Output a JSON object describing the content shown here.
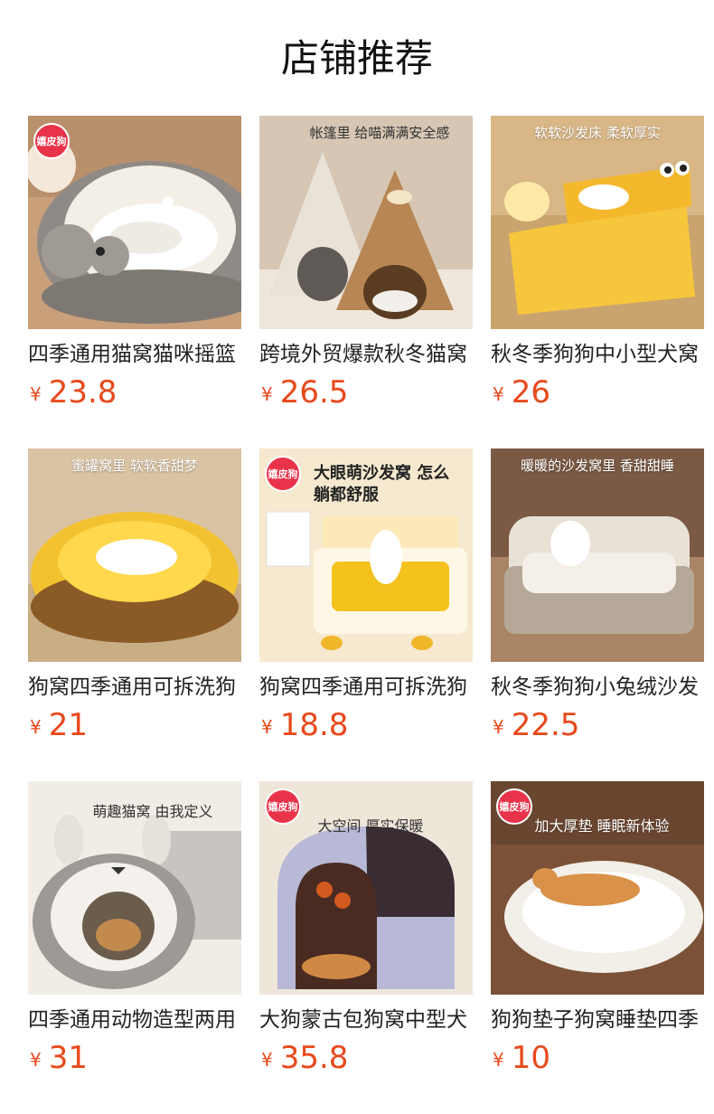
{
  "page": {
    "title": "店铺推荐"
  },
  "brand_badge": "嬉皮狗",
  "currency_symbol": "¥",
  "products": [
    {
      "title": "四季通用猫窝猫咪摇篮",
      "price": "23.8",
      "tagline": "",
      "badge": true
    },
    {
      "title": "跨境外贸爆款秋冬猫窝",
      "price": "26.5",
      "tagline": "帐篷里 给喵满满安全感",
      "badge": false
    },
    {
      "title": "秋冬季狗狗中小型犬窝",
      "price": "26",
      "tagline": "软软沙发床 柔软厚实",
      "badge": false
    },
    {
      "title": "狗窝四季通用可拆洗狗",
      "price": "21",
      "tagline": "蜜罐窝里  软软香甜梦",
      "badge": false
    },
    {
      "title": "狗窝四季通用可拆洗狗",
      "price": "18.8",
      "tagline": "大眼萌沙发窝 怎么躺都舒服",
      "badge": true
    },
    {
      "title": "秋冬季狗狗小兔绒沙发",
      "price": "22.5",
      "tagline": "暖暖的沙发窝里 香甜甜睡",
      "badge": false
    },
    {
      "title": "四季通用动物造型两用",
      "price": "31",
      "tagline": "萌趣猫窝 由我定义",
      "badge": false
    },
    {
      "title": "大狗蒙古包狗窝中型犬",
      "price": "35.8",
      "tagline": "大空间  厚实保暖",
      "badge": true
    },
    {
      "title": "狗狗垫子狗窝睡垫四季",
      "price": "10",
      "tagline": "加大厚垫 睡眠新体验",
      "badge": true
    }
  ]
}
